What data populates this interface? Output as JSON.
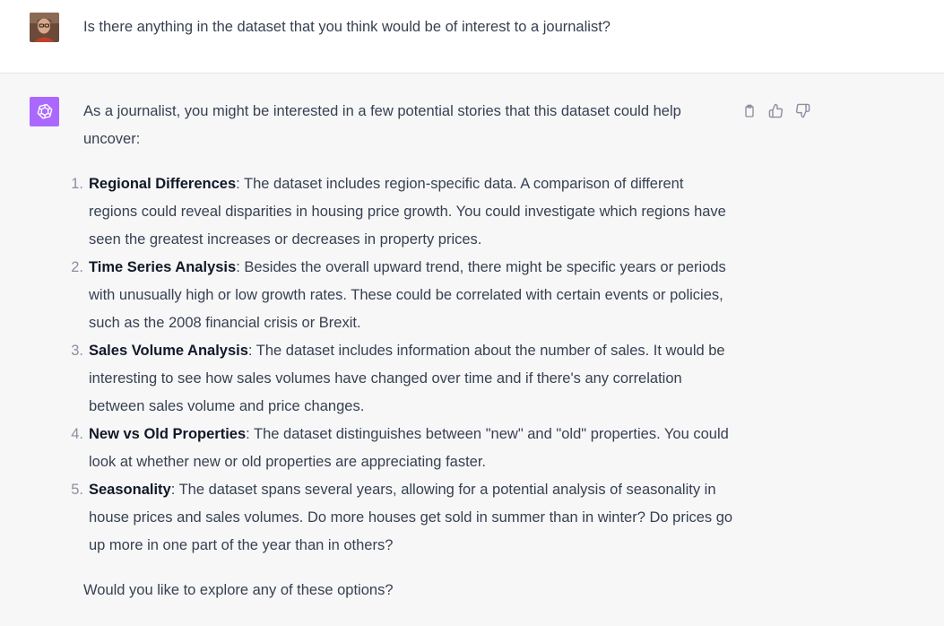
{
  "user_message": {
    "text": "Is there anything in the dataset that you think would be of interest to a journalist?"
  },
  "assistant_message": {
    "intro": "As a journalist, you might be interested in a few potential stories that this dataset could help uncover:",
    "points": [
      {
        "number": "1.",
        "title": "Regional Differences",
        "text": ": The dataset includes region-specific data. A comparison of different regions could reveal disparities in housing price growth. You could investigate which regions have seen the greatest increases or decreases in property prices."
      },
      {
        "number": "2.",
        "title": "Time Series Analysis",
        "text": ": Besides the overall upward trend, there might be specific years or periods with unusually high or low growth rates. These could be correlated with certain events or policies, such as the 2008 financial crisis or Brexit."
      },
      {
        "number": "3.",
        "title": "Sales Volume Analysis",
        "text": ": The dataset includes information about the number of sales. It would be interesting to see how sales volumes have changed over time and if there's any correlation between sales volume and price changes."
      },
      {
        "number": "4.",
        "title": "New vs Old Properties",
        "text": ": The dataset distinguishes between \"new\" and \"old\" properties. You could look at whether new or old properties are appreciating faster."
      },
      {
        "number": "5.",
        "title": "Seasonality",
        "text": ": The dataset spans several years, allowing for a potential analysis of seasonality in house prices and sales volumes. Do more houses get sold in summer than in winter? Do prices go up more in one part of the year than in others?"
      }
    ],
    "outro": "Would you like to explore any of these options?"
  },
  "icons": {
    "copy": "clipboard-icon",
    "thumbs_up": "thumbs-up-icon",
    "thumbs_down": "thumbs-down-icon"
  },
  "colors": {
    "assistant_logo_bg": "#ab68ff",
    "assistant_row_bg": "#f7f7f8",
    "user_row_bg": "#ffffff",
    "text": "#374151"
  }
}
